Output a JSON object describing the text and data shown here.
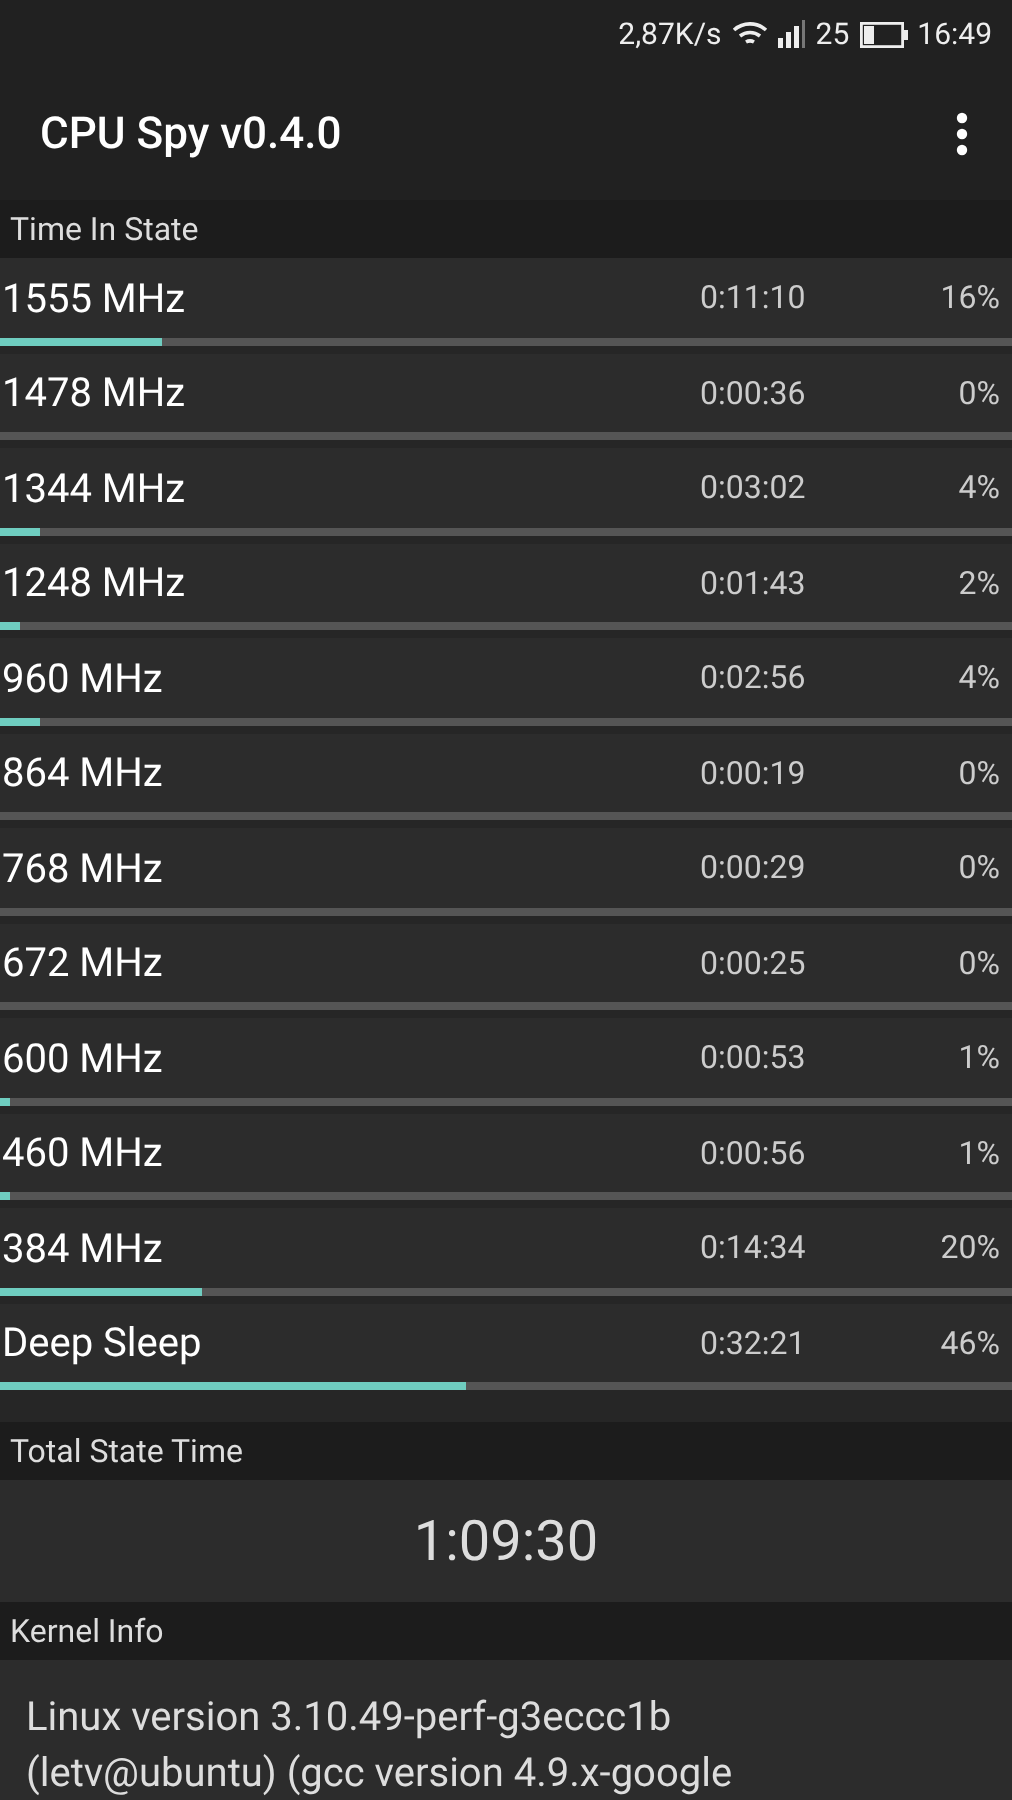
{
  "status_bar": {
    "speed": "2,87K/s",
    "signal_label": "25",
    "time": "16:49"
  },
  "app_bar": {
    "title": "CPU Spy v0.4.0"
  },
  "time_in_state": {
    "header": "Time In State",
    "states": [
      {
        "name": "1555 MHz",
        "time": "0:11:10",
        "percent": "16%",
        "level": 0.16
      },
      {
        "name": "1478 MHz",
        "time": "0:00:36",
        "percent": "0%",
        "level": 0
      },
      {
        "name": "1344 MHz",
        "time": "0:03:02",
        "percent": "4%",
        "level": 0.04
      },
      {
        "name": "1248 MHz",
        "time": "0:01:43",
        "percent": "2%",
        "level": 0.02
      },
      {
        "name": "960 MHz",
        "time": "0:02:56",
        "percent": "4%",
        "level": 0.04
      },
      {
        "name": "864 MHz",
        "time": "0:00:19",
        "percent": "0%",
        "level": 0
      },
      {
        "name": "768 MHz",
        "time": "0:00:29",
        "percent": "0%",
        "level": 0
      },
      {
        "name": "672 MHz",
        "time": "0:00:25",
        "percent": "0%",
        "level": 0
      },
      {
        "name": "600 MHz",
        "time": "0:00:53",
        "percent": "1%",
        "level": 0.01
      },
      {
        "name": "460 MHz",
        "time": "0:00:56",
        "percent": "1%",
        "level": 0.01
      },
      {
        "name": "384 MHz",
        "time": "0:14:34",
        "percent": "20%",
        "level": 0.2
      },
      {
        "name": "Deep Sleep",
        "time": "0:32:21",
        "percent": "46%",
        "level": 0.46
      }
    ]
  },
  "total_state_time": {
    "header": "Total State Time",
    "value": "1:09:30"
  },
  "kernel_info": {
    "header": "Kernel Info",
    "lines": [
      "Linux version 3.10.49-perf-g3eccc1b",
      "(letv@ubuntu) (gcc version 4.9.x-google"
    ]
  }
}
